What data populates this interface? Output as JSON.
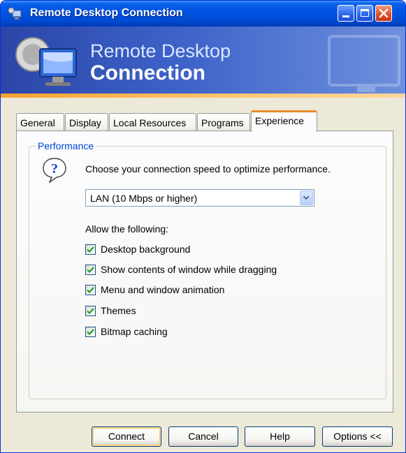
{
  "window": {
    "title": "Remote Desktop Connection"
  },
  "banner": {
    "line1": "Remote Desktop",
    "line2": "Connection"
  },
  "tabs": [
    {
      "label": "General",
      "active": false
    },
    {
      "label": "Display",
      "active": false
    },
    {
      "label": "Local Resources",
      "active": false
    },
    {
      "label": "Programs",
      "active": false
    },
    {
      "label": "Experience",
      "active": true
    }
  ],
  "performance": {
    "group_label": "Performance",
    "prompt": "Choose your connection speed to optimize performance.",
    "speed_selected": "LAN (10 Mbps or higher)",
    "allow_label": "Allow the following:",
    "options": [
      {
        "label": "Desktop background",
        "checked": true
      },
      {
        "label": "Show contents of window while dragging",
        "checked": true
      },
      {
        "label": "Menu and window animation",
        "checked": true
      },
      {
        "label": "Themes",
        "checked": true
      },
      {
        "label": "Bitmap caching",
        "checked": true
      }
    ]
  },
  "buttons": {
    "connect": "Connect",
    "cancel": "Cancel",
    "help": "Help",
    "options": "Options <<"
  },
  "colors": {
    "title_bar": "#0055e5",
    "active_tab_accent": "#e68b2c",
    "group_label": "#0046d5",
    "check_mark": "#21a121"
  }
}
